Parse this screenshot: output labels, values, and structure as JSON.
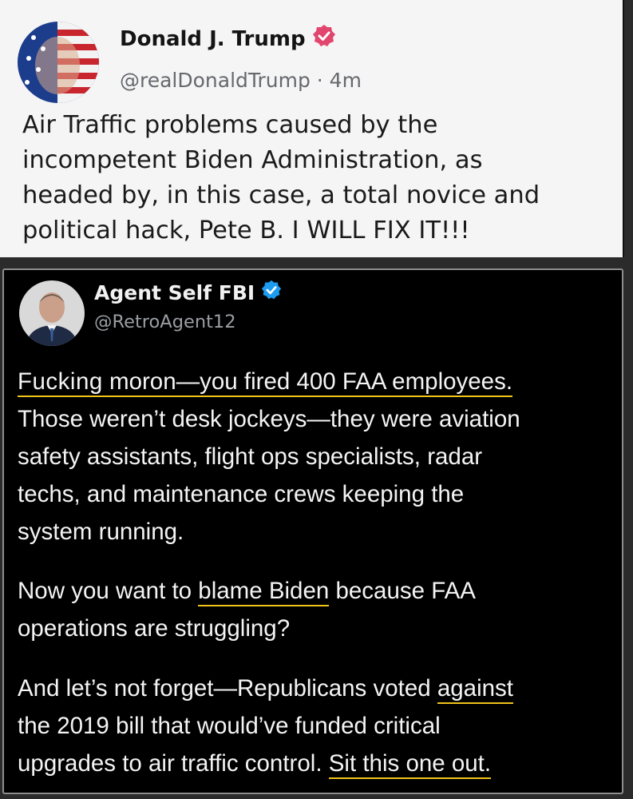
{
  "top_post": {
    "author_name": "Donald J. Trump",
    "handle_line": "@realDonaldTrump · 4m",
    "body_lines": [
      "Air Traffic problems caused by the",
      "incompetent Biden Administration, as",
      "headed by, in this case, a total novice and",
      "political hack, Pete B. I WILL FIX IT!!!"
    ],
    "verified_badge_color": "#e2456d"
  },
  "reply_post": {
    "author_name": "Agent Self FBI",
    "handle": "@RetroAgent12",
    "verified_badge_color": "#1d9bf0",
    "highlight_color": "#f0c419",
    "para1": {
      "line1_word1": "Fucking",
      "line1_rest": " moron—you fired 400 FAA employees.",
      "lines": [
        "Those weren’t desk jockeys—they were aviation",
        "safety assistants, flight ops specialists, radar",
        "techs, and maintenance crews keeping the",
        "system running."
      ]
    },
    "para2": {
      "line1_pre": "Now you want to ",
      "line1_hl": "blame Biden",
      "line1_post": " because FAA",
      "line2": "operations are struggling?"
    },
    "para3": {
      "line1_pre": "And let’s not forget—Republicans voted ",
      "line1_hl": "against",
      "line2": "the 2019 bill that would’ve funded critical",
      "line3_pre": "upgrades to air traffic control. ",
      "line3_hl": "Sit this one out."
    }
  }
}
